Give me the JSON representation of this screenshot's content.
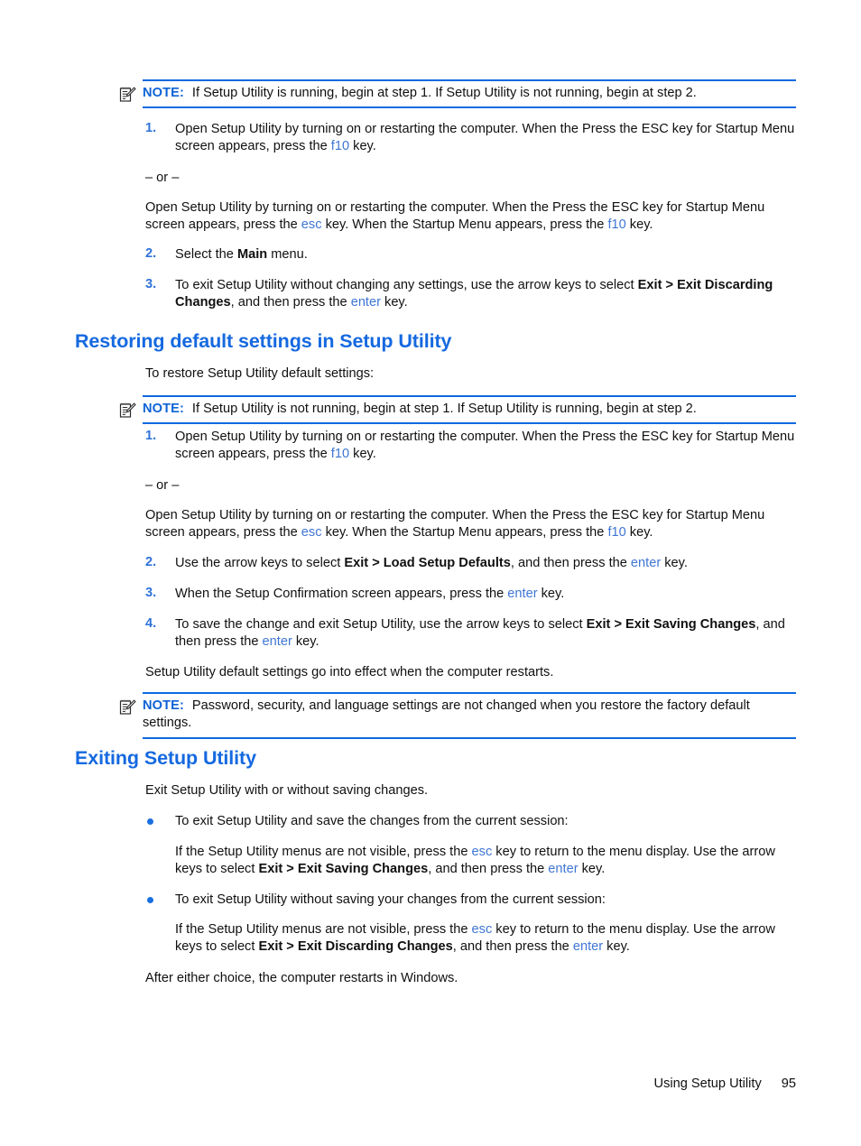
{
  "document": {
    "footer": {
      "section": "Using Setup Utility",
      "page_number": "95"
    }
  },
  "colors": {
    "heading_blue": "#1569e0",
    "note_label_blue": "#0d63d6",
    "key_blue": "#3f76d4",
    "number_blue": "#2f72d8",
    "rule_blue": "#0d6ae0",
    "bullet_blue": "#1a6fe0",
    "body_black": "#101010"
  },
  "icons": {
    "note": "notepad-pencil-icon",
    "bullet": "bullet-dot-icon"
  },
  "notes": {
    "note_label": "NOTE:",
    "note_1": "If Setup Utility is running, begin at step 1. If Setup Utility is not running, begin at step 2.",
    "note_2": "If Setup Utility is not running, begin at step 1. If Setup Utility is running, begin at step 2.",
    "note_3_line1": "Password, security, and language settings are not changed when you restore the factory",
    "note_3_line2": "default settings."
  },
  "section_top": {
    "steps": [
      {
        "num": "1.",
        "text_a": "Open Setup Utility by turning on or restarting the computer. When the Press the ESC key for Startup Menu screen appears, press the ",
        "key_1": "f10",
        "text_b": " key."
      },
      {
        "num": "2.",
        "text_a": "Select the ",
        "bold_1": "Main",
        "text_b": " menu."
      },
      {
        "num": "3.",
        "text_a": "To exit Setup Utility without changing any settings, use the arrow keys to select ",
        "bold_1": "Exit > Exit Discarding Changes",
        "text_b": ", and then press the ",
        "key_1": "enter",
        "text_c": " key."
      }
    ],
    "or_divider": "– or –",
    "alt_step": {
      "text_a": "Open Setup Utility by turning on or restarting the computer. When the Press the ESC key for Startup Menu screen appears, press the ",
      "key_1": "esc",
      "text_b": " key. When the Startup Menu appears, press the ",
      "key_2": "f10",
      "text_c": " key."
    }
  },
  "section_restore": {
    "heading": "Restoring default settings in Setup Utility",
    "intro": "To restore Setup Utility default settings:",
    "or_divider": "– or –",
    "steps": [
      {
        "num": "1.",
        "text_a": "Open Setup Utility by turning on or restarting the computer. When the Press the ESC key for Startup Menu screen appears, press the ",
        "key_1": "f10",
        "text_b": " key."
      },
      {
        "num": "2.",
        "text_a": "Use the arrow keys to select ",
        "bold_1": "Exit > Load Setup Defaults",
        "text_b": ", and then press the ",
        "key_1": "enter",
        "text_c": " key."
      },
      {
        "num": "3.",
        "text_a": "When the Setup Confirmation screen appears, press the ",
        "key_1": "enter",
        "text_b": " key."
      },
      {
        "num": "4.",
        "text_a": "To save the change and exit Setup Utility, use the arrow keys to select ",
        "bold_1": "Exit > Exit Saving Changes",
        "text_b": ", and then press the ",
        "key_1": "enter",
        "text_c": " key."
      }
    ],
    "alt_step": {
      "text_a": "Open Setup Utility by turning on or restarting the computer. When the Press the ESC key for Startup Menu screen appears, press the ",
      "key_1": "esc",
      "text_b": " key. When the Startup Menu appears, press the ",
      "key_2": "f10",
      "text_c": " key."
    },
    "closing": "Setup Utility default settings go into effect when the computer restarts."
  },
  "section_exit": {
    "heading": "Exiting Setup Utility",
    "intro": "Exit Setup Utility with or without saving changes.",
    "bullets": [
      {
        "label": "To exit Setup Utility and save the changes from the current session:",
        "detail_a": "If the Setup Utility menus are not visible, press the ",
        "key_1": "esc",
        "detail_b": " key to return to the menu display. Use the arrow keys to select ",
        "bold_1": "Exit > Exit Saving Changes",
        "detail_c": ", and then press the ",
        "key_2": "enter",
        "detail_d": " key."
      },
      {
        "label": "To exit Setup Utility without saving your changes from the current session:",
        "detail_a": "If the Setup Utility menus are not visible, press the ",
        "key_1": "esc",
        "detail_b": " key to return to the menu display. Use the arrow keys to select ",
        "bold_1": "Exit > Exit Discarding Changes",
        "detail_c": ", and then press the ",
        "key_2": "enter",
        "detail_d": " key."
      }
    ],
    "closing": "After either choice, the computer restarts in Windows."
  }
}
